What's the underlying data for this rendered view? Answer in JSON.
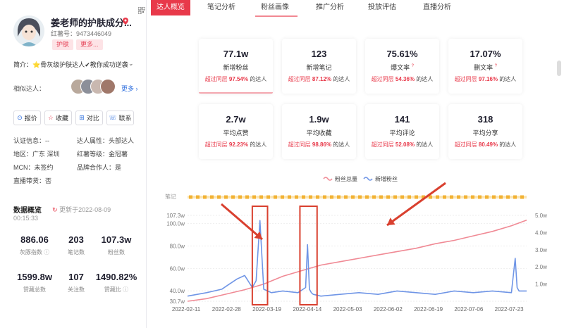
{
  "profile": {
    "name": "姜老师的护肤成分...",
    "redbook_id": "红薯号：9473446049",
    "tags": [
      "护肤",
      "更多..."
    ],
    "bio": "简介：⭐骨灰级护肤达人✔教你成功逆袭",
    "similar_label": "相似达人：",
    "more_link": "更多",
    "actions": [
      {
        "icon": "price-icon",
        "glyph": "⊙",
        "label": "报价",
        "color": "#2f6fde"
      },
      {
        "icon": "star-icon",
        "glyph": "☆",
        "label": "收藏",
        "color": "#e8394a"
      },
      {
        "icon": "compare-icon",
        "glyph": "⊞",
        "label": "对比",
        "color": "#2f6fde"
      },
      {
        "icon": "contact-icon",
        "glyph": "☏",
        "label": "联系",
        "color": "#2f6fde"
      }
    ],
    "attributes": [
      [
        "认证信息：--",
        "达人属性：头部达人"
      ],
      [
        "地区：广东 深圳",
        "红薯等级：金冠薯"
      ],
      [
        "MCN：未签约",
        "品牌合作人：是"
      ],
      [
        "直播带货：否",
        ""
      ]
    ]
  },
  "stats": {
    "title": "数据概览",
    "updated": "更新于2022-08-09",
    "updated_time": "00:15:33",
    "items": [
      {
        "value": "886.06",
        "label": "灰豚指数"
      },
      {
        "value": "203",
        "label": "笔记数"
      },
      {
        "value": "107.3w",
        "label": "粉丝数"
      },
      {
        "value": "1599.8w",
        "label": "赞藏总数"
      },
      {
        "value": "107",
        "label": "关注数"
      },
      {
        "value": "1490.82%",
        "label": "赞藏比"
      }
    ]
  },
  "tabs": [
    "达人概览",
    "笔记分析",
    "粉丝画像",
    "推广分析",
    "投放评估",
    "直播分析"
  ],
  "active_tab": 0,
  "cards": [
    {
      "value": "77.1w",
      "label": "新增粉丝",
      "cmp": "超过同层",
      "pct": "97.54%",
      "tail": "的达人",
      "q": false
    },
    {
      "value": "123",
      "label": "新增笔记",
      "cmp": "超过同层",
      "pct": "87.12%",
      "tail": "的达人",
      "q": false
    },
    {
      "value": "75.61%",
      "label": "爆文率",
      "cmp": "超过同层",
      "pct": "54.36%",
      "tail": "的达人",
      "q": true
    },
    {
      "value": "17.07%",
      "label": "删文率",
      "cmp": "超过同层",
      "pct": "97.16%",
      "tail": "的达人",
      "q": true
    },
    {
      "value": "2.7w",
      "label": "平均点赞",
      "cmp": "超过同层",
      "pct": "92.23%",
      "tail": "的达人",
      "q": false
    },
    {
      "value": "1.9w",
      "label": "平均收藏",
      "cmp": "超过同层",
      "pct": "98.86%",
      "tail": "的达人",
      "q": false
    },
    {
      "value": "141",
      "label": "平均评论",
      "cmp": "超过同层",
      "pct": "52.08%",
      "tail": "的达人",
      "q": false
    },
    {
      "value": "318",
      "label": "平均分享",
      "cmp": "超过同层",
      "pct": "80.49%",
      "tail": "的达人",
      "q": false
    }
  ],
  "colors": {
    "accent": "#e8394a",
    "total_line": "#f08a95",
    "new_line": "#6f95e6",
    "notes": "#f2b233",
    "arrow": "#d9402f"
  },
  "chart_data": {
    "type": "line",
    "legend": [
      {
        "name": "粉丝总量",
        "color": "#f08a95"
      },
      {
        "name": "新增粉丝",
        "color": "#6f95e6"
      }
    ],
    "notes_label": "笔记",
    "x_ticks": [
      "2022-02-11",
      "2022-02-28",
      "2022-03-19",
      "2022-04-14",
      "2022-05-03",
      "2022-06-02",
      "2022-06-19",
      "2022-07-06",
      "2022-07-23"
    ],
    "y_left_ticks": [
      "107.3w",
      "100.0w",
      "80.0w",
      "60.0w",
      "40.0w",
      "30.7w"
    ],
    "y_left_values": [
      107.3,
      100,
      80,
      60,
      40,
      30.7
    ],
    "y_right_ticks": [
      "5.0w",
      "4.0w",
      "3.0w",
      "2.0w",
      "1.0w"
    ],
    "y_right_values": [
      5,
      4,
      3,
      2,
      1
    ],
    "ylim_left": [
      30.7,
      107.3
    ],
    "ylim_right": [
      0,
      5.0
    ],
    "series": [
      {
        "name": "粉丝总量",
        "axis": "left",
        "x": [
          0,
          10,
          20,
          30,
          40,
          50,
          60,
          70,
          80,
          90,
          100,
          110,
          120,
          130,
          140,
          150,
          160,
          170,
          178
        ],
        "values": [
          30.7,
          33,
          37,
          41,
          46,
          53,
          58,
          63,
          66,
          69,
          72,
          75,
          78,
          82,
          85,
          89,
          93,
          98,
          103
        ]
      },
      {
        "name": "新增粉丝",
        "axis": "right",
        "x": [
          0,
          10,
          18,
          22,
          26,
          30,
          34,
          36,
          38,
          40,
          44,
          50,
          58,
          62,
          63,
          64,
          65,
          66,
          70,
          80,
          90,
          100,
          110,
          120,
          130,
          140,
          150,
          160,
          170,
          172,
          173,
          174,
          178
        ],
        "values": [
          0.3,
          0.5,
          0.7,
          1.0,
          1.3,
          1.5,
          0.8,
          1.2,
          4.7,
          0.7,
          0.5,
          0.6,
          0.5,
          0.8,
          3.3,
          0.7,
          0.5,
          0.4,
          0.3,
          0.4,
          0.5,
          0.4,
          0.6,
          0.5,
          0.4,
          0.6,
          0.5,
          0.6,
          0.5,
          2.5,
          0.8,
          0.6,
          0.6
        ]
      }
    ],
    "highlights": [
      {
        "x_from": 34,
        "x_to": 42
      },
      {
        "x_from": 59,
        "x_to": 68
      }
    ]
  }
}
